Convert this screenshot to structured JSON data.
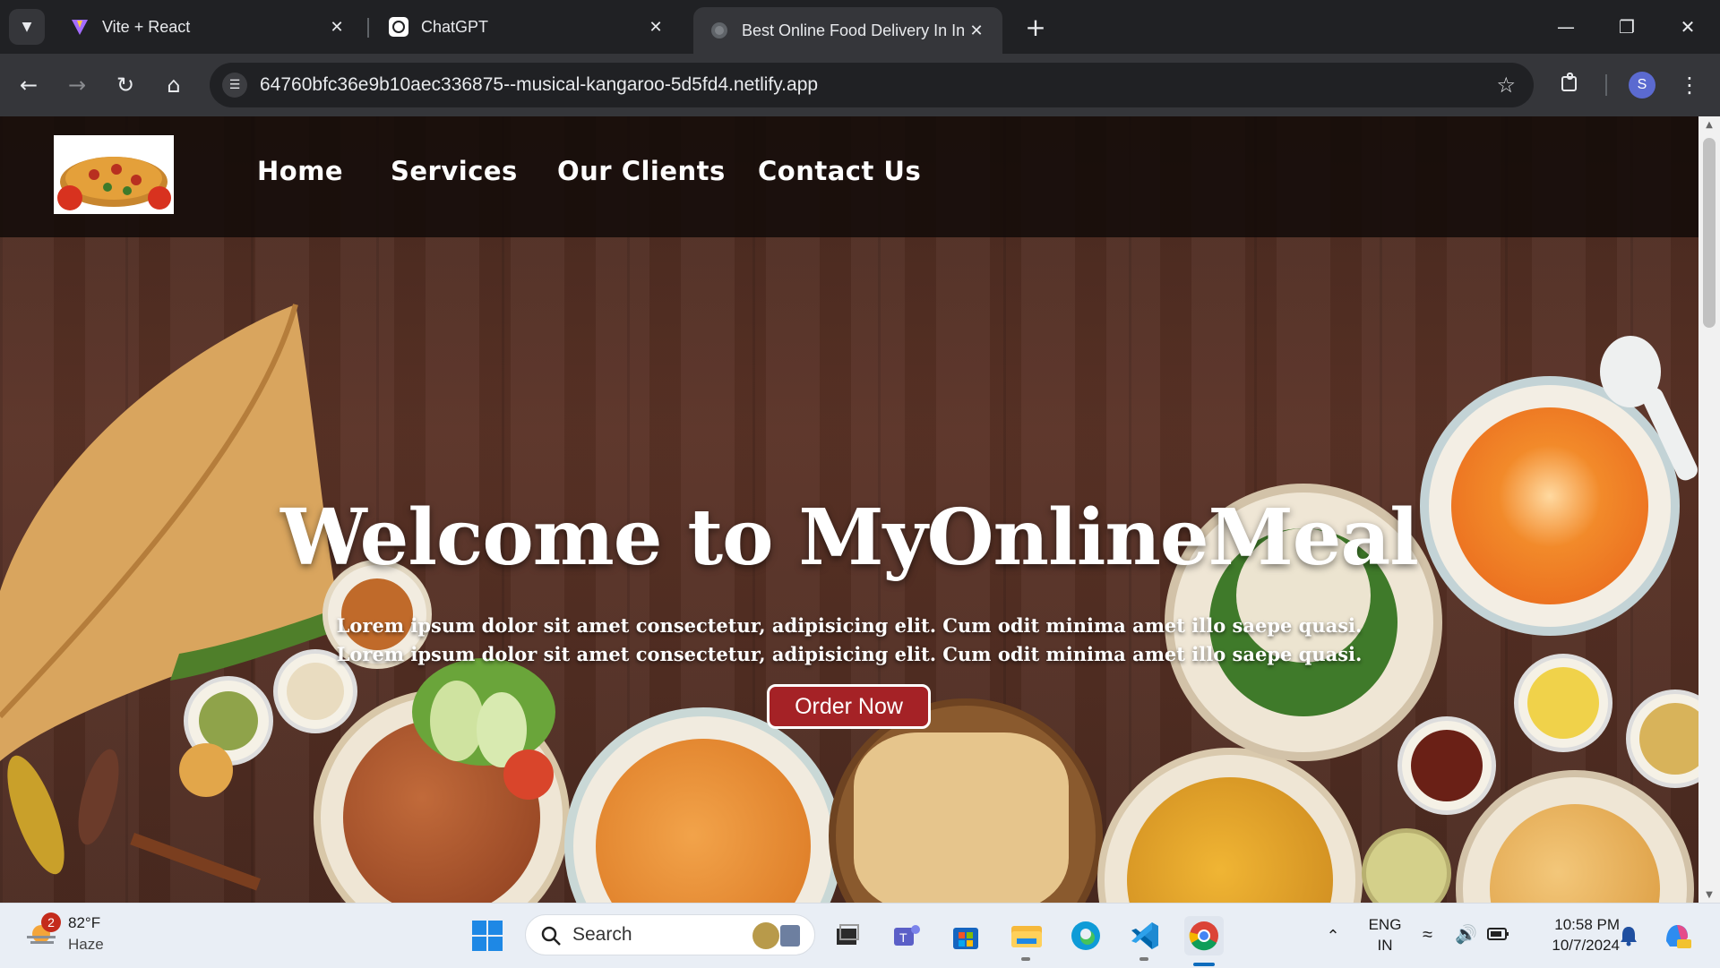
{
  "browser": {
    "tabs": [
      {
        "title": "Vite + React",
        "favicon": "vite-icon"
      },
      {
        "title": "ChatGPT",
        "favicon": "chatgpt-icon"
      },
      {
        "title": "Best Online Food Delivery In Inc",
        "favicon": "globe-icon",
        "active": true
      }
    ],
    "url": "64760bfc36e9b10aec336875--musical-kangaroo-5d5fd4.netlify.app",
    "profile_initial": "S"
  },
  "page": {
    "nav": [
      "Home",
      "Services",
      "Our Clients",
      "Contact Us"
    ],
    "hero_title": "Welcome to MyOnlineMeal",
    "hero_line_1": "Lorem ipsum dolor sit amet consectetur, adipisicing elit. Cum odit minima amet illo saepe quasi.",
    "hero_line_2": "Lorem ipsum dolor sit amet consectetur, adipisicing elit. Cum odit minima amet illo saepe quasi.",
    "order_button": "Order Now",
    "colors": {
      "accent": "#a52226",
      "wood": "#4a2a20"
    }
  },
  "taskbar": {
    "weather_badge": "2",
    "temperature": "82°F",
    "condition": "Haze",
    "search_label": "Search",
    "lang_top": "ENG",
    "lang_bottom": "IN",
    "time": "10:58 PM",
    "date": "10/7/2024"
  }
}
